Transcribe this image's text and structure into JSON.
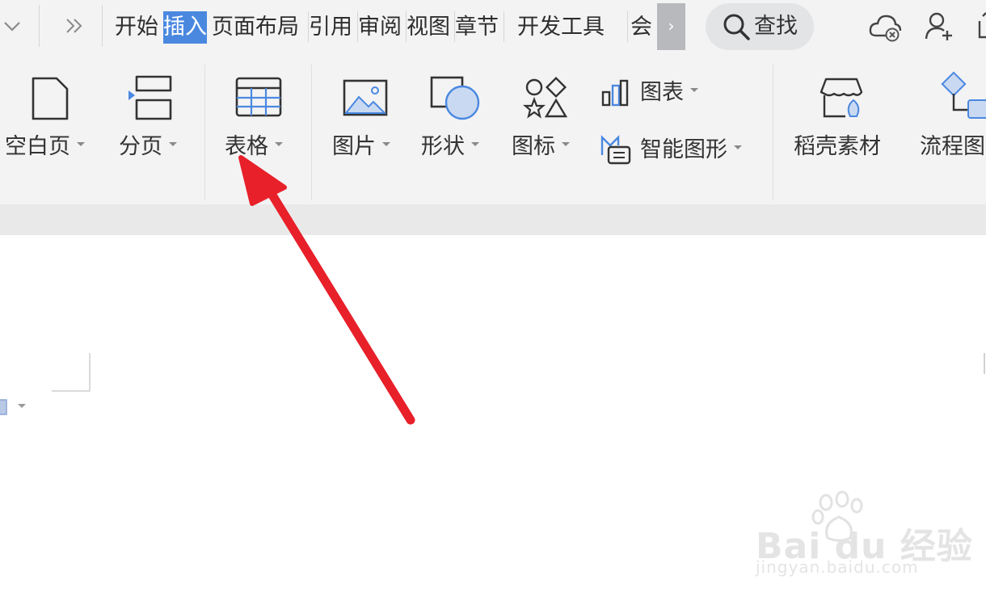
{
  "menu": {
    "collapse_icon": "chevron-down-icon",
    "more_icon": "double-chevron-right-icon",
    "tabs": [
      "开始",
      "插入",
      "页面布局",
      "引用",
      "审阅",
      "视图",
      "章节",
      "开发工具",
      "会"
    ],
    "active_tab": "插入",
    "search_label": "查找",
    "scroll_icon": "chevron-right-icon",
    "right_icons": [
      "cloud-sync-icon",
      "add-user-icon",
      "share-icon"
    ]
  },
  "ribbon": {
    "blank_page": "空白页",
    "page_break": "分页",
    "table": "表格",
    "picture": "图片",
    "shape": "形状",
    "icon": "图标",
    "chart": "图表",
    "smart_art": "智能图形",
    "docer_material": "稻壳素材",
    "flowchart": "流程图"
  },
  "watermark": {
    "brand": "Bai du 经验",
    "url": "jingyan.baidu.com"
  },
  "colors": {
    "accent": "#4a88e0",
    "arrow": "#e8202a",
    "ribbon_bg": "#f3f3f4"
  }
}
